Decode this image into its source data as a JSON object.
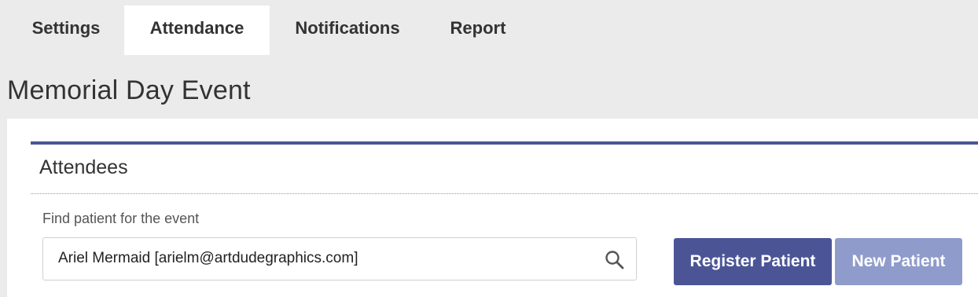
{
  "tabs": [
    {
      "label": "Settings"
    },
    {
      "label": "Attendance"
    },
    {
      "label": "Notifications"
    },
    {
      "label": "Report"
    }
  ],
  "page": {
    "title": "Memorial Day Event"
  },
  "attendees": {
    "title": "Attendees",
    "find_label": "Find patient for the event",
    "search_value": "Ariel Mermaid [arielm@artdudegraphics.com]",
    "search_icon": "search-icon",
    "register_button": "Register Patient",
    "new_button": "New Patient"
  },
  "colors": {
    "accent": "#4b5596",
    "accent_light": "#8f9ccb",
    "background": "#ebebeb"
  }
}
